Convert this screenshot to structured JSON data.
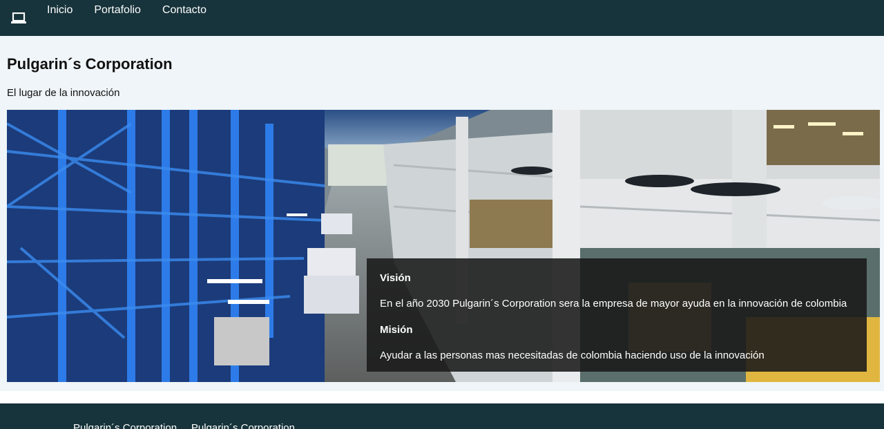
{
  "nav": {
    "logo_icon": "laptop-icon",
    "links": [
      "Inicio",
      "Portafolio",
      "Contacto"
    ]
  },
  "header": {
    "title": "Pulgarin´s Corporation",
    "subtitle": "El lugar de la innovación"
  },
  "hero": {
    "image": "warehouse-photo",
    "vision_heading": "Visión",
    "vision_text": "En el año 2030 Pulgarin´s Corporation sera la empresa de mayor ayuda en la innovación de colombia",
    "mission_heading": "Misión",
    "mission_text": "Ayudar a las personas mas necesitadas de colombia haciendo uso de la innovación"
  },
  "footer": {
    "text": "Pulgarin´s Corporation ... Pulgarin´s Corporation"
  },
  "colors": {
    "nav_bg": "#17333b",
    "main_bg": "#eff5f8",
    "caption_bg": "#191919"
  }
}
